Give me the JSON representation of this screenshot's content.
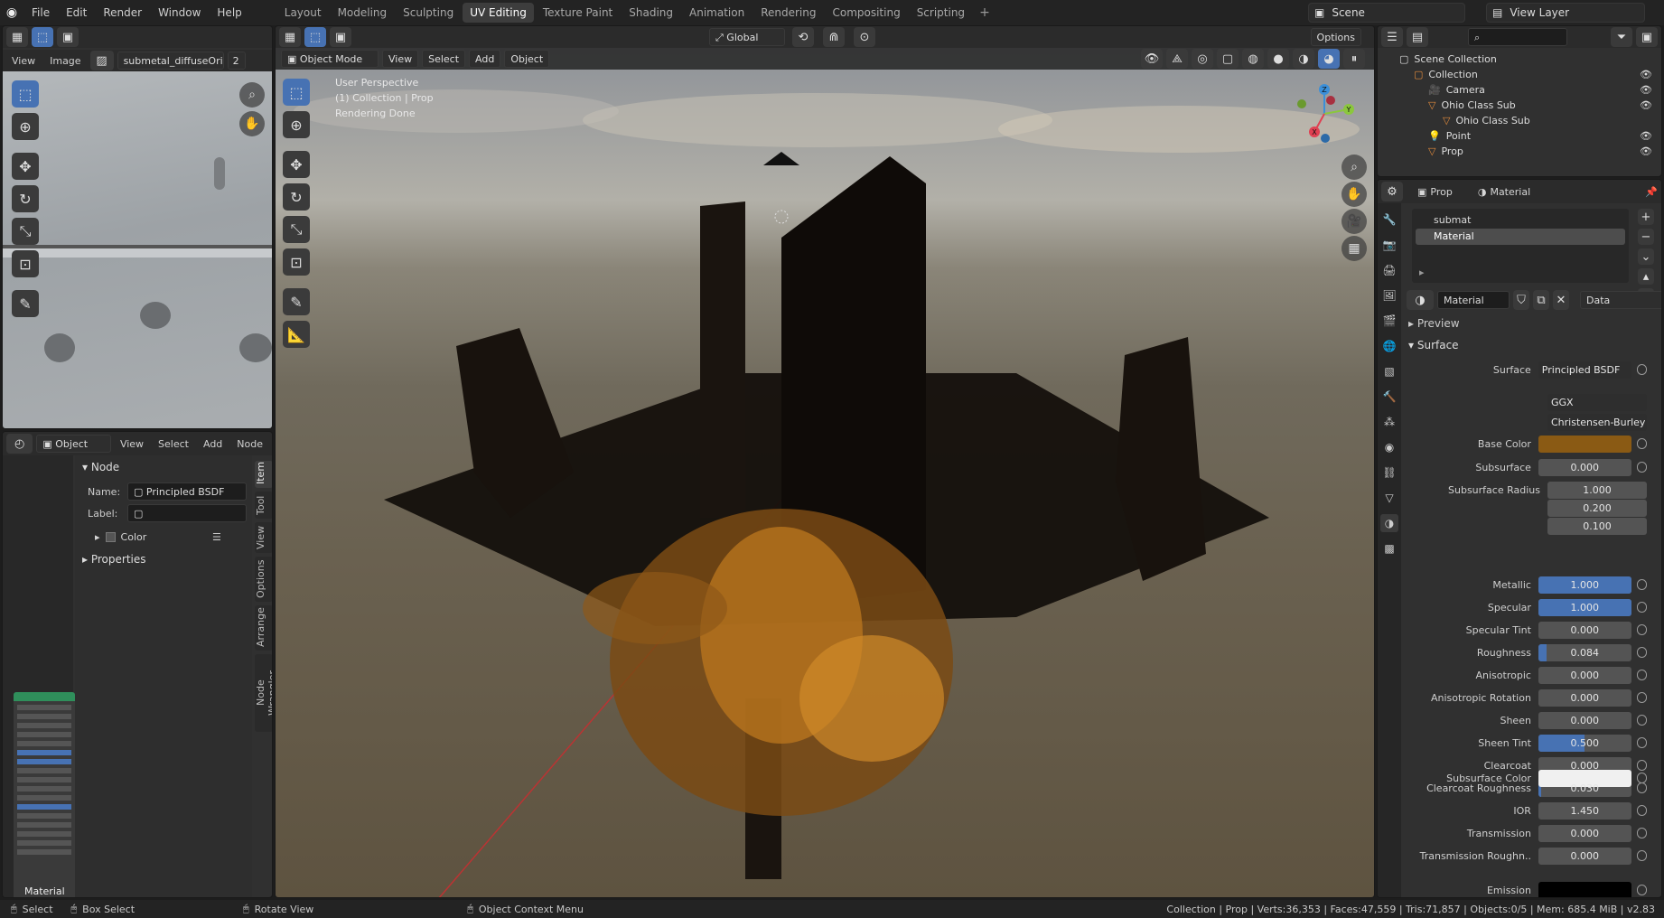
{
  "menu": [
    "File",
    "Edit",
    "Render",
    "Window",
    "Help"
  ],
  "workspaces": [
    "Layout",
    "Modeling",
    "Sculpting",
    "UV Editing",
    "Texture Paint",
    "Shading",
    "Animation",
    "Rendering",
    "Compositing",
    "Scripting"
  ],
  "active_workspace": "UV Editing",
  "scene": "Scene",
  "view_layer": "View Layer",
  "image_editor": {
    "menus": [
      "View",
      "Image"
    ],
    "image_name": "submetal_diffuseOri...",
    "users": "2"
  },
  "viewport_header": {
    "transform_orientation": "Global",
    "options": "Options",
    "mode": "Object Mode",
    "menus": [
      "View",
      "Select",
      "Add",
      "Object"
    ]
  },
  "viewport_overlay": {
    "line1": "User Perspective",
    "line2": "(1) Collection | Prop",
    "line3": "Rendering Done"
  },
  "gizmo_axes": {
    "x": "X",
    "y": "Y",
    "z": "Z"
  },
  "node_editor": {
    "mode": "Object",
    "menus": [
      "View",
      "Select",
      "Add",
      "Node"
    ],
    "section_node": "Node",
    "name_label": "Name:",
    "name_value": "Principled BSDF",
    "label_label": "Label:",
    "label_value": "",
    "color_label": "Color",
    "properties_label": "Properties",
    "side_tabs": [
      "Item",
      "Tool",
      "View",
      "Options",
      "Arrange",
      "Node Wrangler"
    ],
    "minimap_title": "Material"
  },
  "outliner": {
    "scene_collection": "Scene Collection",
    "items": [
      {
        "name": "Collection",
        "indent": 1
      },
      {
        "name": "Camera",
        "indent": 2
      },
      {
        "name": "Ohio Class Sub",
        "indent": 2
      },
      {
        "name": "Ohio Class Sub",
        "indent": 3
      },
      {
        "name": "Point",
        "indent": 2
      },
      {
        "name": "Prop",
        "indent": 2
      }
    ]
  },
  "properties": {
    "breadcrumb_object": "Prop",
    "breadcrumb_tab": "Material",
    "slots": [
      "submat",
      "Material"
    ],
    "active_slot": "Material",
    "material_name": "Material",
    "link": "Data",
    "preview": "Preview",
    "surface_section": "Surface",
    "surface_label": "Surface",
    "surface_value": "Principled BSDF",
    "distribution": "GGX",
    "subsurface_method": "Christensen-Burley",
    "base_color_label": "Base Color",
    "base_color": "#8a5a14",
    "subsurface_color_label": "Subsurface Color",
    "subsurface_color": "#f0f0f0",
    "emission_label": "Emission",
    "emission_color": "#000000",
    "rows": [
      {
        "label": "Subsurface",
        "value": "0.000",
        "fill": 0
      },
      {
        "label": "Subsurface Radius",
        "value": "1.000",
        "fill": 0
      },
      {
        "label": "",
        "value": "0.200",
        "fill": 0
      },
      {
        "label": "",
        "value": "0.100",
        "fill": 0
      },
      {
        "label": "Metallic",
        "value": "1.000",
        "fill": 1
      },
      {
        "label": "Specular",
        "value": "1.000",
        "fill": 1
      },
      {
        "label": "Specular Tint",
        "value": "0.000",
        "fill": 0
      },
      {
        "label": "Roughness",
        "value": "0.084",
        "fill": 0.084
      },
      {
        "label": "Anisotropic",
        "value": "0.000",
        "fill": 0
      },
      {
        "label": "Anisotropic Rotation",
        "value": "0.000",
        "fill": 0
      },
      {
        "label": "Sheen",
        "value": "0.000",
        "fill": 0
      },
      {
        "label": "Sheen Tint",
        "value": "0.500",
        "fill": 0.5
      },
      {
        "label": "Clearcoat",
        "value": "0.000",
        "fill": 0
      },
      {
        "label": "Clearcoat Roughness",
        "value": "0.030",
        "fill": 0.03
      },
      {
        "label": "IOR",
        "value": "1.450",
        "fill": 0
      },
      {
        "label": "Transmission",
        "value": "0.000",
        "fill": 0
      },
      {
        "label": "Transmission Roughn..",
        "value": "0.000",
        "fill": 0
      }
    ]
  },
  "statusbar": {
    "select": "Select",
    "box_select": "Box Select",
    "rotate_view": "Rotate View",
    "context_menu": "Object Context Menu",
    "stats": "Collection | Prop | Verts:36,353 | Faces:47,559 | Tris:71,857 | Objects:0/5 | Mem: 685.4 MiB | v2.83"
  }
}
